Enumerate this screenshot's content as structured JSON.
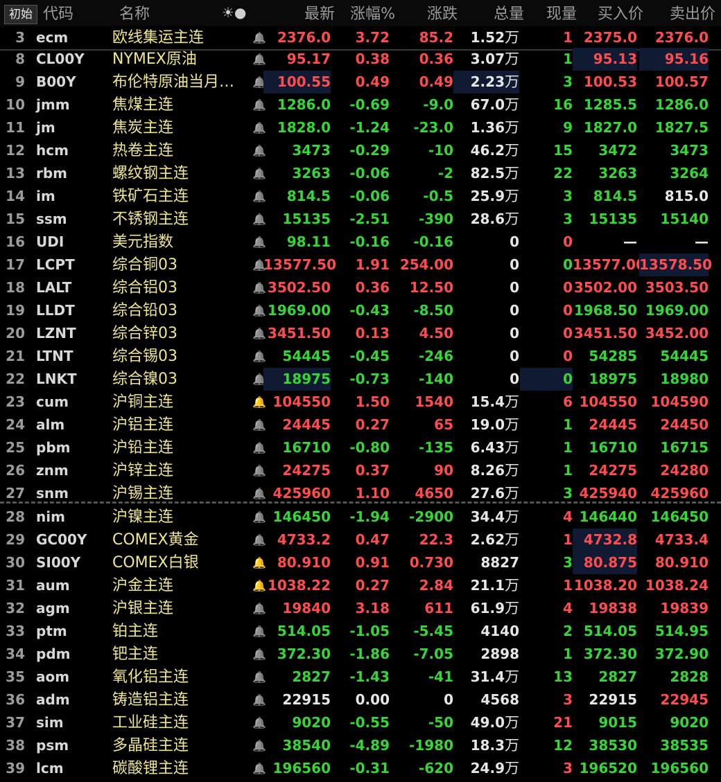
{
  "header": {
    "init_button": "初始",
    "columns": {
      "code": "代码",
      "name": "名称",
      "icons": "☀●",
      "last": "最新",
      "pct": "涨幅%",
      "chg": "涨跌",
      "vol": "总量",
      "cur": "现量",
      "bid": "买入价",
      "ask": "卖出价"
    }
  },
  "colors": {
    "up": "#ff4d4d",
    "down": "#36d636",
    "flat": "#e6e6e6",
    "name": "#f0e68c",
    "alert": "#ff4500",
    "highlight": "#101a33"
  },
  "rows": [
    {
      "idx": "3",
      "code": "ecm",
      "name": "欧线集运主连",
      "alert": "off",
      "last": "2376.0",
      "pct": "3.72",
      "chg": "85.2",
      "vol": "1.52",
      "vol_unit": "万",
      "cur": "1",
      "bid": "2375.0",
      "ask": "2376.0",
      "dir": "up",
      "cur_dir": "up",
      "bid_dir": "up",
      "ask_dir": "up"
    },
    {
      "idx": "8",
      "code": "CL00Y",
      "name": "NYMEX原油",
      "alert": "off",
      "last": "95.17",
      "pct": "0.38",
      "chg": "0.36",
      "vol": "3.07",
      "vol_unit": "万",
      "cur": "1",
      "bid": "95.13",
      "ask": "95.16",
      "dir": "up",
      "cur_dir": "down",
      "bid_dir": "up",
      "ask_dir": "up"
    },
    {
      "idx": "9",
      "code": "B00Y",
      "name": "布伦特原油当月…",
      "alert": "off",
      "last": "100.55",
      "pct": "0.49",
      "chg": "0.49",
      "vol": "2.23",
      "vol_unit": "万",
      "cur": "3",
      "bid": "100.53",
      "ask": "100.57",
      "dir": "up",
      "cur_dir": "down",
      "bid_dir": "up",
      "ask_dir": "up"
    },
    {
      "idx": "10",
      "code": "jmm",
      "name": "焦煤主连",
      "alert": "off",
      "last": "1286.0",
      "pct": "-0.69",
      "chg": "-9.0",
      "vol": "67.0",
      "vol_unit": "万",
      "cur": "16",
      "bid": "1285.5",
      "ask": "1286.0",
      "dir": "down",
      "cur_dir": "down",
      "bid_dir": "down",
      "ask_dir": "down"
    },
    {
      "idx": "11",
      "code": "jm",
      "name": "焦炭主连",
      "alert": "off",
      "last": "1828.0",
      "pct": "-1.24",
      "chg": "-23.0",
      "vol": "1.36",
      "vol_unit": "万",
      "cur": "9",
      "bid": "1827.0",
      "ask": "1827.5",
      "dir": "down",
      "cur_dir": "down",
      "bid_dir": "down",
      "ask_dir": "down"
    },
    {
      "idx": "12",
      "code": "hcm",
      "name": "热卷主连",
      "alert": "off",
      "last": "3473",
      "pct": "-0.29",
      "chg": "-10",
      "vol": "46.2",
      "vol_unit": "万",
      "cur": "15",
      "bid": "3472",
      "ask": "3473",
      "dir": "down",
      "cur_dir": "down",
      "bid_dir": "down",
      "ask_dir": "down"
    },
    {
      "idx": "13",
      "code": "rbm",
      "name": "螺纹钢主连",
      "alert": "off",
      "last": "3263",
      "pct": "-0.06",
      "chg": "-2",
      "vol": "82.5",
      "vol_unit": "万",
      "cur": "22",
      "bid": "3263",
      "ask": "3264",
      "dir": "down",
      "cur_dir": "down",
      "bid_dir": "down",
      "ask_dir": "down"
    },
    {
      "idx": "14",
      "code": "im",
      "name": "铁矿石主连",
      "alert": "off",
      "last": "814.5",
      "pct": "-0.06",
      "chg": "-0.5",
      "vol": "25.9",
      "vol_unit": "万",
      "cur": "3",
      "bid": "814.5",
      "ask": "815.0",
      "dir": "down",
      "cur_dir": "down",
      "bid_dir": "down",
      "ask_dir": "flat"
    },
    {
      "idx": "15",
      "code": "ssm",
      "name": "不锈钢主连",
      "alert": "off",
      "last": "15135",
      "pct": "-2.51",
      "chg": "-390",
      "vol": "28.6",
      "vol_unit": "万",
      "cur": "3",
      "bid": "15135",
      "ask": "15140",
      "dir": "down",
      "cur_dir": "down",
      "bid_dir": "down",
      "ask_dir": "down"
    },
    {
      "idx": "16",
      "code": "UDI",
      "name": "美元指数",
      "alert": "off",
      "last": "98.11",
      "pct": "-0.16",
      "chg": "-0.16",
      "vol": "0",
      "vol_unit": "",
      "cur": "0",
      "bid": "—",
      "ask": "—",
      "dir": "down",
      "cur_dir": "up",
      "bid_dir": "flat",
      "ask_dir": "flat"
    },
    {
      "idx": "17",
      "code": "LCPT",
      "name": "综合铜03",
      "alert": "off",
      "last": "13577.50",
      "pct": "1.91",
      "chg": "254.00",
      "vol": "0",
      "vol_unit": "",
      "cur": "0",
      "bid": "13577.00",
      "ask": "13578.50",
      "dir": "up",
      "cur_dir": "down",
      "bid_dir": "up",
      "ask_dir": "up"
    },
    {
      "idx": "18",
      "code": "LALT",
      "name": "综合铝03",
      "alert": "off",
      "last": "3502.50",
      "pct": "0.36",
      "chg": "12.50",
      "vol": "0",
      "vol_unit": "",
      "cur": "0",
      "bid": "3502.00",
      "ask": "3503.50",
      "dir": "up",
      "cur_dir": "up",
      "bid_dir": "up",
      "ask_dir": "up"
    },
    {
      "idx": "19",
      "code": "LLDT",
      "name": "综合铅03",
      "alert": "off",
      "last": "1969.00",
      "pct": "-0.43",
      "chg": "-8.50",
      "vol": "0",
      "vol_unit": "",
      "cur": "0",
      "bid": "1968.50",
      "ask": "1969.00",
      "dir": "down",
      "cur_dir": "up",
      "bid_dir": "down",
      "ask_dir": "down"
    },
    {
      "idx": "20",
      "code": "LZNT",
      "name": "综合锌03",
      "alert": "off",
      "last": "3451.50",
      "pct": "0.13",
      "chg": "4.50",
      "vol": "0",
      "vol_unit": "",
      "cur": "0",
      "bid": "3451.50",
      "ask": "3452.00",
      "dir": "up",
      "cur_dir": "up",
      "bid_dir": "up",
      "ask_dir": "up"
    },
    {
      "idx": "21",
      "code": "LTNT",
      "name": "综合锡03",
      "alert": "off",
      "last": "54445",
      "pct": "-0.45",
      "chg": "-246",
      "vol": "0",
      "vol_unit": "",
      "cur": "0",
      "bid": "54285",
      "ask": "54445",
      "dir": "down",
      "cur_dir": "up",
      "bid_dir": "down",
      "ask_dir": "down"
    },
    {
      "idx": "22",
      "code": "LNKT",
      "name": "综合镍03",
      "alert": "off",
      "last": "18975",
      "pct": "-0.73",
      "chg": "-140",
      "vol": "0",
      "vol_unit": "",
      "cur": "0",
      "bid": "18975",
      "ask": "18980",
      "dir": "down",
      "cur_dir": "down",
      "bid_dir": "down",
      "ask_dir": "down"
    },
    {
      "idx": "23",
      "code": "cum",
      "name": "沪铜主连",
      "alert": "on",
      "last": "104550",
      "pct": "1.50",
      "chg": "1540",
      "vol": "15.4",
      "vol_unit": "万",
      "cur": "6",
      "bid": "104550",
      "ask": "104590",
      "dir": "up",
      "cur_dir": "up",
      "bid_dir": "up",
      "ask_dir": "up"
    },
    {
      "idx": "24",
      "code": "alm",
      "name": "沪铝主连",
      "alert": "off",
      "last": "24445",
      "pct": "0.27",
      "chg": "65",
      "vol": "19.0",
      "vol_unit": "万",
      "cur": "1",
      "bid": "24445",
      "ask": "24450",
      "dir": "up",
      "cur_dir": "down",
      "bid_dir": "up",
      "ask_dir": "up"
    },
    {
      "idx": "25",
      "code": "pbm",
      "name": "沪铅主连",
      "alert": "off",
      "last": "16710",
      "pct": "-0.80",
      "chg": "-135",
      "vol": "6.43",
      "vol_unit": "万",
      "cur": "1",
      "bid": "16710",
      "ask": "16715",
      "dir": "down",
      "cur_dir": "down",
      "bid_dir": "down",
      "ask_dir": "down"
    },
    {
      "idx": "26",
      "code": "znm",
      "name": "沪锌主连",
      "alert": "off",
      "last": "24275",
      "pct": "0.37",
      "chg": "90",
      "vol": "8.26",
      "vol_unit": "万",
      "cur": "1",
      "bid": "24275",
      "ask": "24280",
      "dir": "up",
      "cur_dir": "down",
      "bid_dir": "up",
      "ask_dir": "up"
    },
    {
      "idx": "27",
      "code": "snm",
      "name": "沪锡主连",
      "alert": "off",
      "last": "425960",
      "pct": "1.10",
      "chg": "4650",
      "vol": "27.6",
      "vol_unit": "万",
      "cur": "3",
      "bid": "425940",
      "ask": "425960",
      "dir": "up",
      "cur_dir": "down",
      "bid_dir": "up",
      "ask_dir": "up"
    },
    {
      "idx": "28",
      "code": "nim",
      "name": "沪镍主连",
      "alert": "off",
      "last": "146450",
      "pct": "-1.94",
      "chg": "-2900",
      "vol": "34.4",
      "vol_unit": "万",
      "cur": "4",
      "bid": "146440",
      "ask": "146450",
      "dir": "down",
      "cur_dir": "up",
      "bid_dir": "down",
      "ask_dir": "down"
    },
    {
      "idx": "29",
      "code": "GC00Y",
      "name": "COMEX黄金",
      "alert": "off",
      "last": "4733.2",
      "pct": "0.47",
      "chg": "22.3",
      "vol": "2.62",
      "vol_unit": "万",
      "cur": "1",
      "bid": "4732.8",
      "ask": "4733.4",
      "dir": "up",
      "cur_dir": "up",
      "bid_dir": "up",
      "ask_dir": "up"
    },
    {
      "idx": "30",
      "code": "SI00Y",
      "name": "COMEX白银",
      "alert": "on",
      "last": "80.910",
      "pct": "0.91",
      "chg": "0.730",
      "vol": "8827",
      "vol_unit": "",
      "cur": "3",
      "bid": "80.875",
      "ask": "80.910",
      "dir": "up",
      "cur_dir": "down",
      "bid_dir": "up",
      "ask_dir": "up"
    },
    {
      "idx": "31",
      "code": "aum",
      "name": "沪金主连",
      "alert": "on",
      "last": "1038.22",
      "pct": "0.27",
      "chg": "2.84",
      "vol": "21.1",
      "vol_unit": "万",
      "cur": "1",
      "bid": "1038.20",
      "ask": "1038.24",
      "dir": "up",
      "cur_dir": "up",
      "bid_dir": "up",
      "ask_dir": "up"
    },
    {
      "idx": "32",
      "code": "agm",
      "name": "沪银主连",
      "alert": "off",
      "last": "19840",
      "pct": "3.18",
      "chg": "611",
      "vol": "61.9",
      "vol_unit": "万",
      "cur": "4",
      "bid": "19838",
      "ask": "19839",
      "dir": "up",
      "cur_dir": "up",
      "bid_dir": "up",
      "ask_dir": "up"
    },
    {
      "idx": "33",
      "code": "ptm",
      "name": "铂主连",
      "alert": "off",
      "last": "514.05",
      "pct": "-1.05",
      "chg": "-5.45",
      "vol": "4140",
      "vol_unit": "",
      "cur": "2",
      "bid": "514.05",
      "ask": "514.95",
      "dir": "down",
      "cur_dir": "down",
      "bid_dir": "down",
      "ask_dir": "down"
    },
    {
      "idx": "34",
      "code": "pdm",
      "name": "钯主连",
      "alert": "off",
      "last": "372.30",
      "pct": "-1.86",
      "chg": "-7.05",
      "vol": "2898",
      "vol_unit": "",
      "cur": "1",
      "bid": "372.30",
      "ask": "372.90",
      "dir": "down",
      "cur_dir": "down",
      "bid_dir": "down",
      "ask_dir": "down"
    },
    {
      "idx": "35",
      "code": "aom",
      "name": "氧化铝主连",
      "alert": "off",
      "last": "2827",
      "pct": "-1.43",
      "chg": "-41",
      "vol": "31.4",
      "vol_unit": "万",
      "cur": "13",
      "bid": "2827",
      "ask": "2828",
      "dir": "down",
      "cur_dir": "down",
      "bid_dir": "down",
      "ask_dir": "down"
    },
    {
      "idx": "36",
      "code": "adm",
      "name": "铸造铝主连",
      "alert": "off",
      "last": "22915",
      "pct": "0.00",
      "chg": "0",
      "vol": "4568",
      "vol_unit": "",
      "cur": "3",
      "bid": "22915",
      "ask": "22945",
      "dir": "flat",
      "cur_dir": "up",
      "bid_dir": "flat",
      "ask_dir": "up"
    },
    {
      "idx": "37",
      "code": "sim",
      "name": "工业硅主连",
      "alert": "off",
      "last": "9020",
      "pct": "-0.55",
      "chg": "-50",
      "vol": "49.0",
      "vol_unit": "万",
      "cur": "21",
      "bid": "9015",
      "ask": "9020",
      "dir": "down",
      "cur_dir": "up",
      "bid_dir": "down",
      "ask_dir": "down"
    },
    {
      "idx": "38",
      "code": "psm",
      "name": "多晶硅主连",
      "alert": "off",
      "last": "38540",
      "pct": "-4.89",
      "chg": "-1980",
      "vol": "18.3",
      "vol_unit": "万",
      "cur": "12",
      "bid": "38530",
      "ask": "38535",
      "dir": "down",
      "cur_dir": "down",
      "bid_dir": "down",
      "ask_dir": "down"
    },
    {
      "idx": "39",
      "code": "lcm",
      "name": "碳酸锂主连",
      "alert": "off",
      "last": "196560",
      "pct": "-0.31",
      "chg": "-620",
      "vol": "24.9",
      "vol_unit": "万",
      "cur": "3",
      "bid": "196520",
      "ask": "196560",
      "dir": "down",
      "cur_dir": "up",
      "bid_dir": "down",
      "ask_dir": "down"
    }
  ]
}
